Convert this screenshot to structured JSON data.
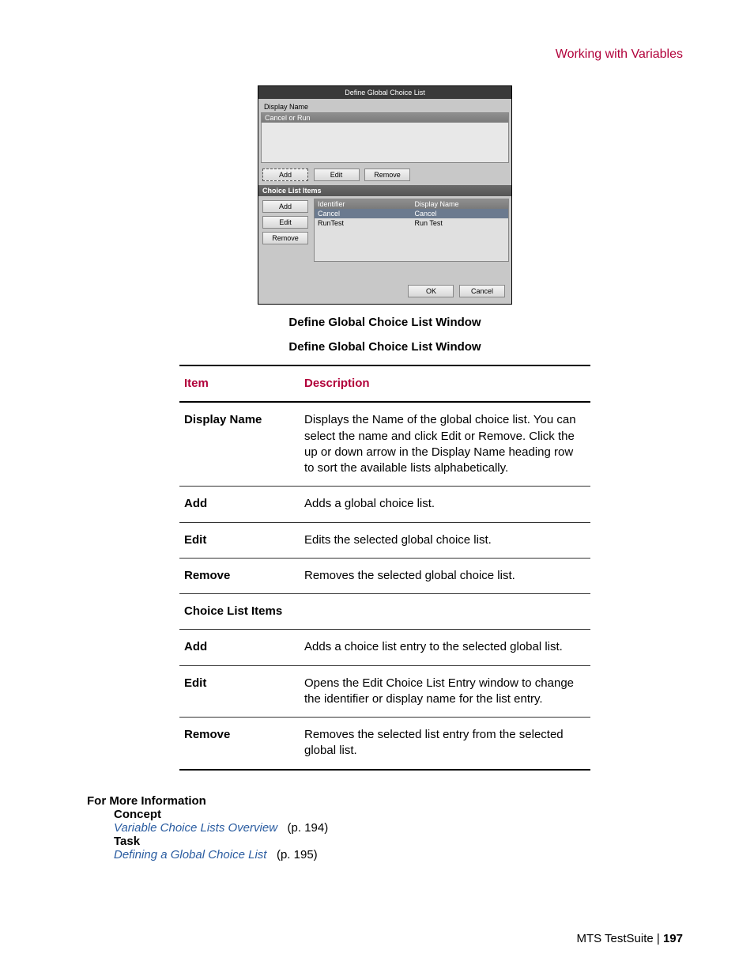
{
  "header": {
    "breadcrumb": "Working with Variables"
  },
  "screenshot": {
    "title": "Define Global Choice List",
    "displayNameLabel": "Display Name",
    "listRow": "Cancel or Run",
    "buttons": {
      "add": "Add",
      "edit": "Edit",
      "remove": "Remove"
    },
    "section": "Choice List Items",
    "itemsButtons": {
      "add": "Add",
      "edit": "Edit",
      "remove": "Remove"
    },
    "itemsHeader": {
      "identifier": "Identifier",
      "displayName": "Display Name"
    },
    "items": [
      {
        "identifier": "Cancel",
        "displayName": "Cancel"
      },
      {
        "identifier": "RunTest",
        "displayName": "Run Test"
      }
    ],
    "footer": {
      "ok": "OK",
      "cancel": "Cancel"
    }
  },
  "captions": {
    "fig": "Define Global Choice List Window",
    "tableTitle": "Define Global Choice List Window"
  },
  "tableHeader": {
    "item": "Item",
    "description": "Description"
  },
  "rows": [
    {
      "item": "Display Name",
      "desc": "Displays the Name of the global choice list. You can select the name and click Edit or Remove. Click the up or down arrow in the Display Name heading row to sort the available lists alphabetically."
    },
    {
      "item": "Add",
      "desc": "Adds a global choice list."
    },
    {
      "item": "Edit",
      "desc": "Edits the selected global choice list."
    },
    {
      "item": "Remove",
      "desc": "Removes the selected global choice list."
    }
  ],
  "sectionRow": "Choice List Items",
  "rows2": [
    {
      "item": "Add",
      "desc": "Adds a choice list entry to the selected global list."
    },
    {
      "item": "Edit",
      "desc": "Opens the Edit Choice List Entry window to change the identifier or display name for the list entry."
    },
    {
      "item": "Remove",
      "desc": "Removes the selected list entry from the selected global list."
    }
  ],
  "moreInfo": {
    "heading": "For More Information",
    "concept": "Concept",
    "conceptLink": "Variable Choice Lists Overview",
    "conceptPage": "(p. 194)",
    "task": "Task",
    "taskLink": "Defining a Global Choice List",
    "taskPage": "(p. 195)"
  },
  "footer": {
    "product": "MTS TestSuite",
    "sep": " | ",
    "page": "197"
  }
}
